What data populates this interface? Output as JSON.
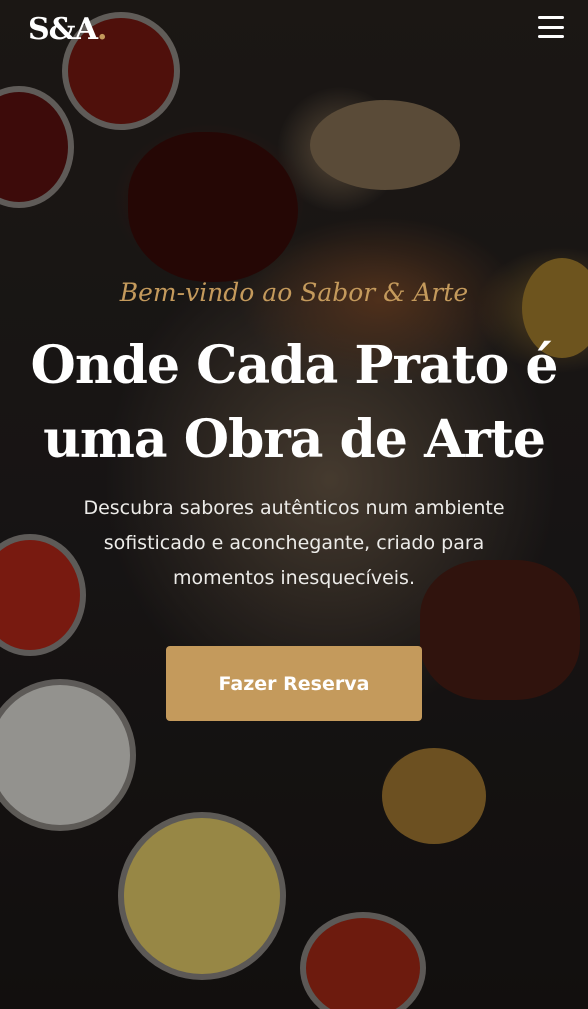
{
  "header": {
    "logo_text": "S&A",
    "logo_dot": ".",
    "menu_icon": "hamburger-menu-icon"
  },
  "hero": {
    "eyebrow": "Bem-vindo ao Sabor & Arte",
    "headline_line1": "Onde Cada Prato é",
    "headline_line2": "uma Obra de Arte",
    "subtitle_line1": "Descubra sabores autênticos num ambiente",
    "subtitle_line2": "sofisticado e aconchegante, criado para",
    "subtitle_line3": "momentos inesquecíveis.",
    "cta_label": "Fazer Reserva"
  },
  "colors": {
    "accent": "#c49a5c",
    "text": "#ffffff"
  }
}
